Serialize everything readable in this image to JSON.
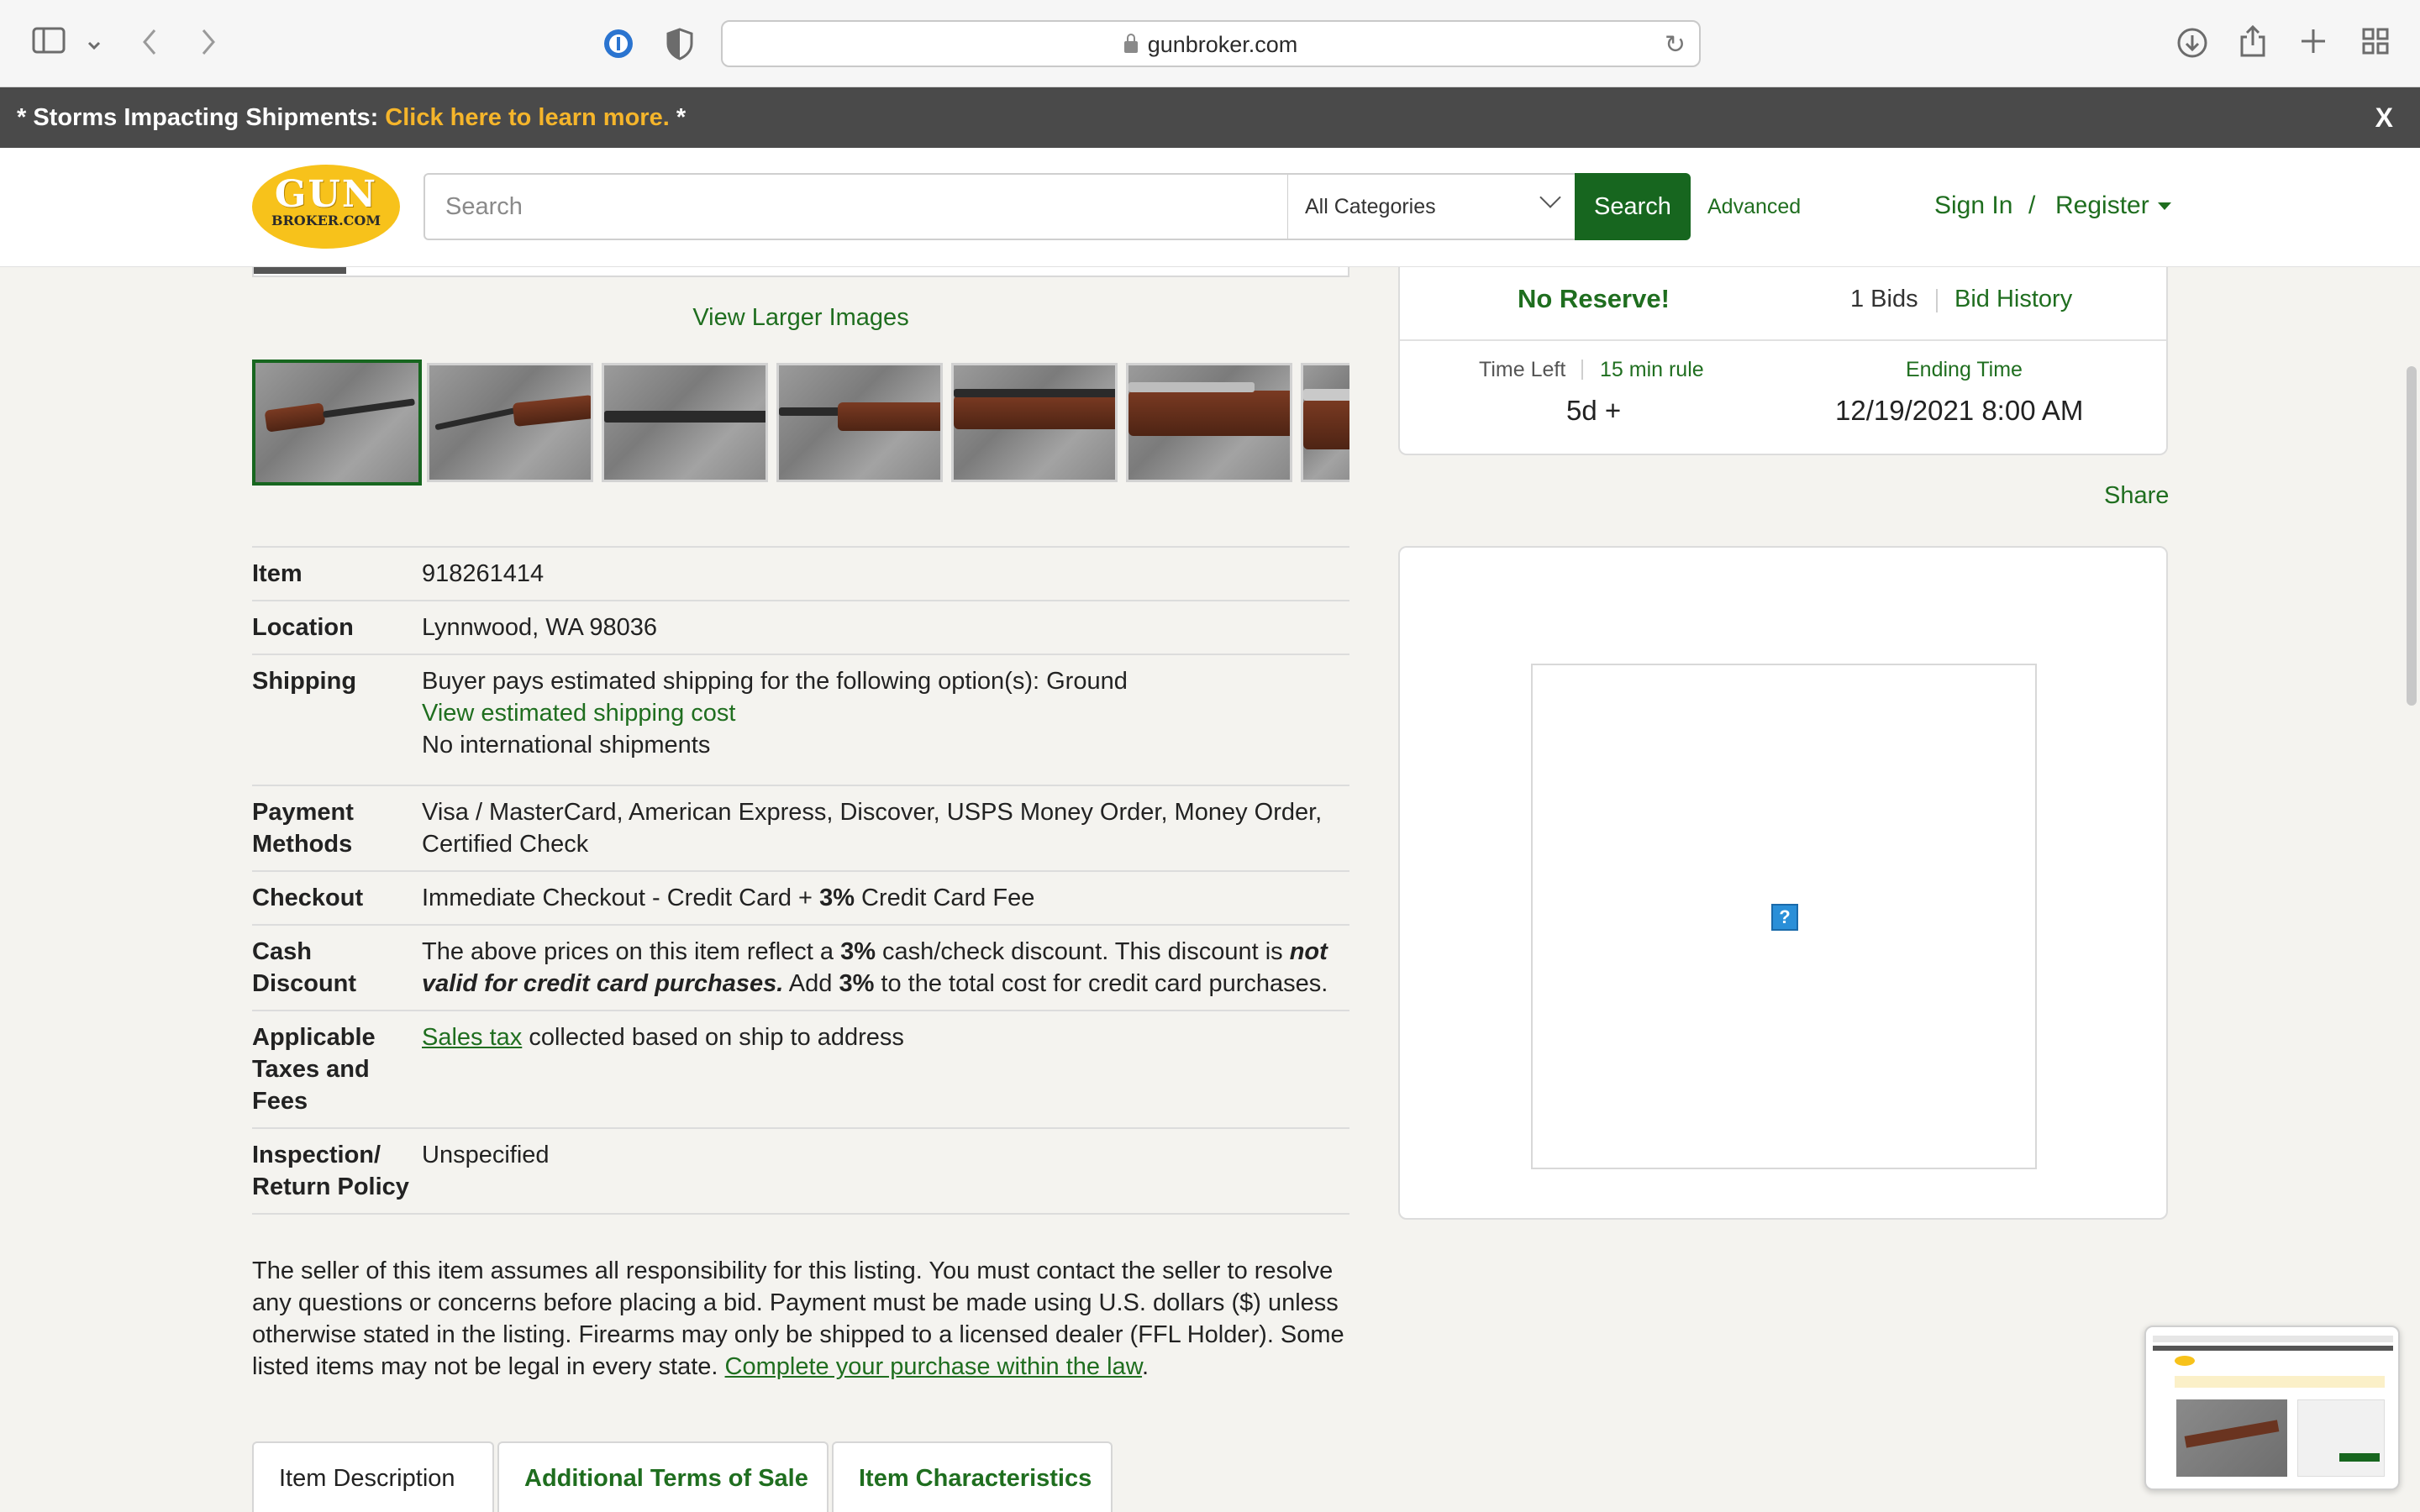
{
  "browser": {
    "url": "gunbroker.com"
  },
  "alert": {
    "prefix": "* Storms Impacting Shipments: ",
    "link": "Click here to learn more.",
    "suffix": " *",
    "close": "X"
  },
  "header": {
    "logo_top": "GUN",
    "logo_bottom": "BROKER.COM",
    "search_placeholder": "Search",
    "category": "All Categories",
    "search_button": "Search",
    "advanced": "Advanced",
    "sign_in": "Sign In",
    "separator": "/",
    "register": "Register"
  },
  "gallery": {
    "view_larger": "View Larger Images"
  },
  "specs": [
    {
      "key": "Item",
      "value": "918261414"
    },
    {
      "key": "Location",
      "value": "Lynnwood, WA 98036"
    }
  ],
  "shipping": {
    "key": "Shipping",
    "line1": "Buyer pays estimated shipping for the following option(s): Ground",
    "link": "View estimated shipping cost",
    "line3": "No international shipments"
  },
  "payment": {
    "key": "Payment Methods",
    "value": "Visa / MasterCard, American Express, Discover, USPS Money Order, Money Order, Certified Check"
  },
  "checkout": {
    "key": "Checkout",
    "value_a": "Immediate Checkout - Credit Card + ",
    "value_bold": "3%",
    "value_b": " Credit Card Fee"
  },
  "cash_discount": {
    "key": "Cash Discount",
    "t1": "The above prices on this item reflect a ",
    "b1": "3%",
    "t2": " cash/check discount. This discount is ",
    "bi": "not valid for credit card purchases.",
    "t3": " Add ",
    "b2": "3%",
    "t4": " to the total cost for credit card purchases."
  },
  "taxes": {
    "key": "Applicable Taxes and Fees",
    "link": "Sales tax",
    "rest": " collected based on ship to address"
  },
  "inspection": {
    "key": "Inspection/ Return Policy",
    "value": "Unspecified"
  },
  "disclaimer": {
    "text": "The seller of this item assumes all responsibility for this listing. You must contact the seller to resolve any questions or concerns before placing a bid. Payment must be made using U.S. dollars ($) unless otherwise stated in the listing. Firearms may only be shipped to a licensed dealer (FFL Holder). Some listed items may not be legal in every state. ",
    "link": "Complete your purchase within the law",
    "end": "."
  },
  "tabs": [
    "Item Description",
    "Additional Terms of Sale",
    "Item Characteristics"
  ],
  "bid": {
    "no_reserve": "No Reserve!",
    "bids": "1 Bids",
    "bid_history": "Bid History",
    "time_left_label": "Time Left",
    "min_rule": "15 min rule",
    "time_left": "5d +",
    "ending_label": "Ending Time",
    "ending_time": "12/19/2021 8:00 AM"
  },
  "share": "Share",
  "ad": {
    "placeholder": "?"
  },
  "colors": {
    "brand_green": "#17661f",
    "link_green": "#1f6e1f",
    "alert_bg": "#4a4a4a",
    "alert_link": "#f5b52b",
    "logo_yellow": "#f7c21b"
  }
}
